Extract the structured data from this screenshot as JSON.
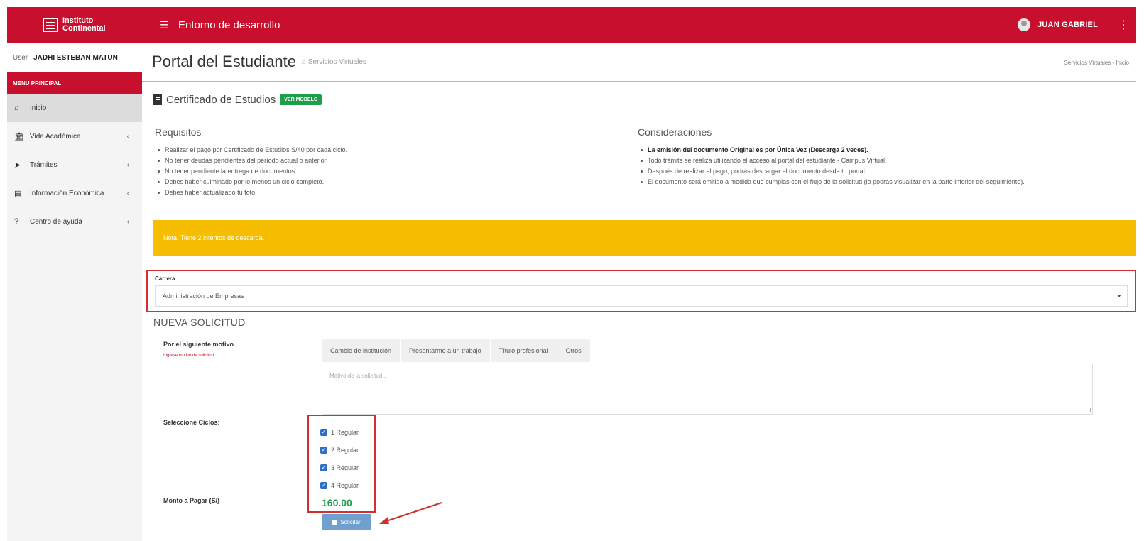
{
  "header": {
    "logo_line1": "Instituto",
    "logo_line2": "Continental",
    "menu_icon": "hamburger-icon",
    "environment_title": "Entorno de desarrollo",
    "user_name": "JUAN GABRIEL",
    "brand_color": "#c8102e"
  },
  "sidebar": {
    "user_image_alt": "User",
    "user_name": "JADHI ESTEBAN MATUN",
    "menu_header": "MENU PRINCIPAL",
    "items": [
      {
        "label": "Inicio",
        "icon": "home-icon",
        "active": true
      },
      {
        "label": "Vida Académica",
        "icon": "bank-icon",
        "active": false
      },
      {
        "label": "Trámites",
        "icon": "send-icon",
        "active": false
      },
      {
        "label": "Información Económica",
        "icon": "document-icon",
        "active": false
      },
      {
        "label": "Centro de ayuda",
        "icon": "question-icon",
        "active": false
      }
    ]
  },
  "page": {
    "title": "Portal del Estudiante",
    "subtitle": "Servicios Virtuales",
    "breadcrumb": "Servicios Virtuales › Inicio"
  },
  "certificate": {
    "title": "Certificado de Estudios",
    "badge": "VER MODELO"
  },
  "requisitos": {
    "title": "Requisitos",
    "items": [
      "Realizar el pago por Certificado de Estudios S/40 por cada ciclo.",
      "No tener deudas pendientes del período actual o anterior.",
      "No tener pendiente la entrega de documentos.",
      "Debes haber culminado por lo menos un ciclo completo.",
      "Debes haber actualizado tu foto."
    ]
  },
  "consideraciones": {
    "title": "Consideraciones",
    "items": [
      "La emisión del documento Original es por Única Vez (Descarga 2 veces).",
      "Todo trámite se realiza utilizando el acceso al portal del estudiante - Campus Virtual.",
      "Después de realizar el pago, podrás descargar el documento desde tu portal.",
      "El documento será emitido a medida que cumplas con el flujo de la solicitud (lo podrás visualizar en la parte inferior del seguimiento)."
    ]
  },
  "note": "Nota: Tiene 2 intentos de descarga.",
  "carrera": {
    "label": "Carrera",
    "selected": "Administración de Empresas"
  },
  "nueva_solicitud": {
    "title": "NUEVA SOLICITUD",
    "motivo_label": "Por el siguiente motivo",
    "motivo_hint": "Ingrese motivo de solicitud",
    "tabs": [
      "Cambio de institución",
      "Presentarme a un trabajo",
      "Título profesional",
      "Otros"
    ],
    "textarea_placeholder": "Motivo de la solicitud...",
    "ciclos_label": "Seleccione Ciclos:",
    "ciclos": [
      "1 Regular",
      "2 Regular",
      "3 Regular",
      "4 Regular"
    ],
    "monto_label": "Monto a Pagar (S/)",
    "monto_value": "160.00",
    "submit_label": "Solicitar"
  }
}
